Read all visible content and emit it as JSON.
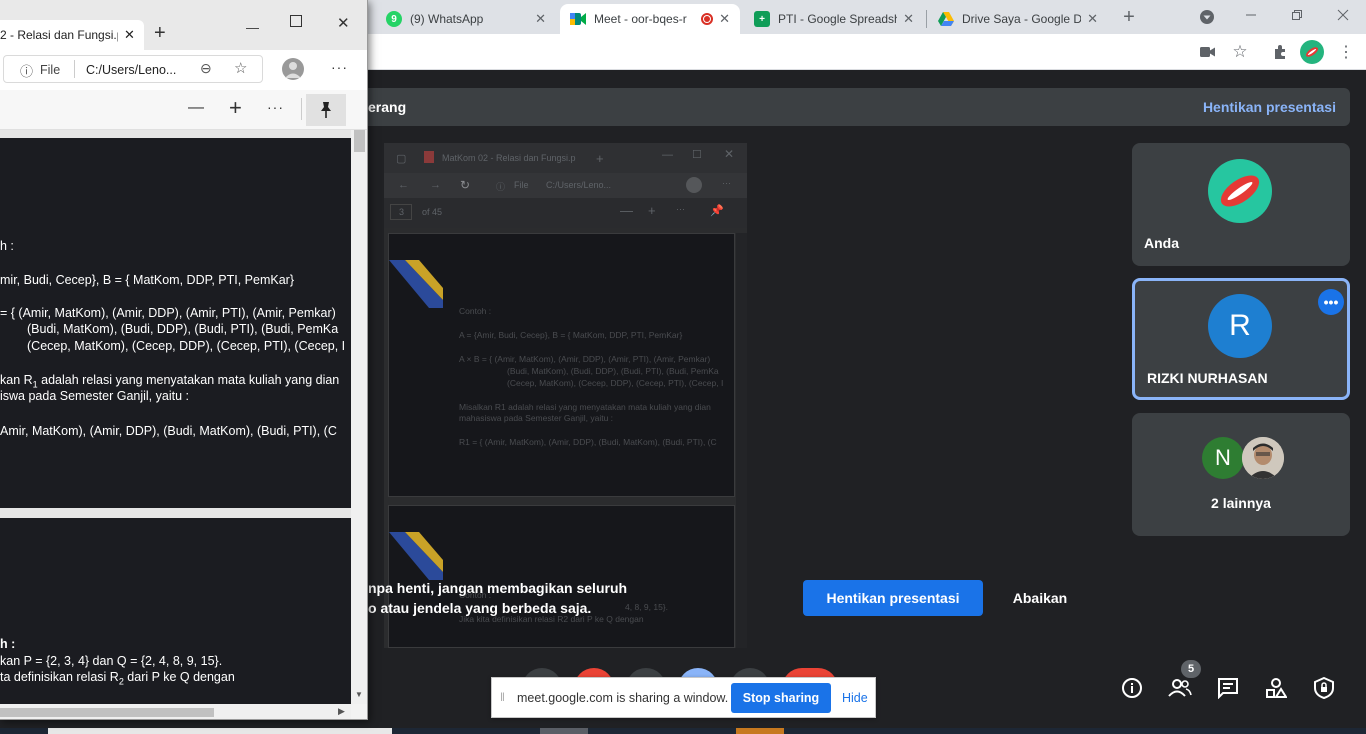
{
  "chrome": {
    "tabs": [
      {
        "title": "(9) WhatsApp",
        "icon": "whatsapp-icon",
        "color": "#25d366"
      },
      {
        "title": "Meet - oor-bqes-r",
        "icon": "meet-icon",
        "color": "#00897b"
      },
      {
        "title": "PTI - Google Spreadsh",
        "icon": "sheets-icon",
        "color": "#0f9d58"
      },
      {
        "title": "Drive Saya - Google D",
        "icon": "drive-icon",
        "color": "#fbbc04"
      }
    ],
    "new_tab": "+",
    "tab_close": "✕"
  },
  "meet": {
    "banner_text": "erang",
    "banner_stop": "Hentikan presentasi",
    "participants": [
      {
        "name": "Anda"
      },
      {
        "name": "RIZKI NURHASAN",
        "initial": "R"
      },
      {
        "name": "2 lainnya",
        "initial": "N"
      }
    ],
    "warning_line1": "npa henti, jangan membagikan seluruh",
    "warning_line2": "o atau jendela yang berbeda saja.",
    "stop_button": "Hentikan presentasi",
    "ignore_button": "Abaikan",
    "people_count": "5"
  },
  "preview": {
    "tab_title": "MatKom 02 - Relasi dan Fungsi.p",
    "address": "C:/Users/Leno...",
    "file_label": "File",
    "page_of": "of 45",
    "page_num": "3",
    "lines": [
      "Contoh :",
      "A = {Amir, Budi, Cecep},  B = { MatKom, DDP, PTI, PemKar}",
      "A × B = { (Amir, MatKom), (Amir, DDP), (Amir, PTI),  (Amir, Pemkar)",
      "(Budi, MatKom), (Budi, DDP), (Budi, PTI), (Budi, PemKa",
      "(Cecep, MatKom), (Cecep, DDP), (Cecep, PTI), (Cecep, I",
      "Misalkan R1 adalah relasi yang menyatakan mata kuliah yang  dian",
      "mahasiswa pada Semester Ganjil, yaitu :",
      "R1 = { (Amir, MatKom), (Amir, DDP), (Budi, MatKom), (Budi, PTI), (C"
    ],
    "lines2": [
      "Contoh :",
      "4, 8, 9, 15}.",
      "Jika kita definisikan relasi R2 dari P ke Q dengan"
    ]
  },
  "sharing_bar": {
    "text": "meet.google.com is sharing a window.",
    "stop": "Stop sharing",
    "hide": "Hide"
  },
  "edge": {
    "tab_title": "2 - Relasi dan Fungsi.p",
    "file_label": "File",
    "address": "C:/Users/Leno...",
    "page1": {
      "heading": "h :",
      "line_a": "mir, Budi, Cecep},  B = { MatKom, DDP, PTI, PemKar}",
      "line_b1": "= { (Amir, MatKom), (Amir, DDP), (Amir, PTI),  (Amir, Pemkar)",
      "line_b2": "(Budi, MatKom), (Budi, DDP), (Budi, PTI), (Budi, PemKa",
      "line_b3": "(Cecep, MatKom), (Cecep, DDP), (Cecep, PTI), (Cecep, I",
      "line_c1_pre": "kan R",
      "line_c1_sub": "1",
      "line_c1_post": " adalah relasi yang menyatakan mata kuliah yang  dian",
      "line_c2": "iswa pada Semester Ganjil, yaitu :",
      "line_d": "Amir, MatKom), (Amir, DDP), (Budi, MatKom), (Budi, PTI), (C"
    },
    "page2": {
      "heading": "h :",
      "line_a": "kan P = {2, 3, 4} dan Q = {2, 4, 8, 9, 15}.",
      "line_b_pre": "ta definisikan relasi R",
      "line_b_sub": "2",
      "line_b_post": " dari P ke Q dengan"
    }
  }
}
